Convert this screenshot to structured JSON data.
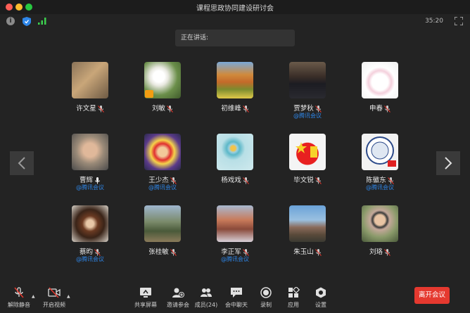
{
  "window": {
    "title": "课程思政协同建设研讨会"
  },
  "topbar": {
    "timer": "35:20"
  },
  "speaking": {
    "label": "正在讲话:"
  },
  "participants": [
    {
      "name": "许文星",
      "org": ""
    },
    {
      "name": "刘敏",
      "org": ""
    },
    {
      "name": "初维峰",
      "org": ""
    },
    {
      "name": "贾梦秋",
      "org": "@腾讯会议"
    },
    {
      "name": "申春",
      "org": ""
    },
    {
      "name": "曹辉",
      "org": "@腾讯会议"
    },
    {
      "name": "王少杰",
      "org": "@腾讯会议"
    },
    {
      "name": "杨戏戏",
      "org": ""
    },
    {
      "name": "毕文锐",
      "org": ""
    },
    {
      "name": "陈徽东",
      "org": "@腾讯会议"
    },
    {
      "name": "蔡昀",
      "org": "@腾讯会议"
    },
    {
      "name": "张桂敏",
      "org": ""
    },
    {
      "name": "李正军",
      "org": "@腾讯会议"
    },
    {
      "name": "朱玉山",
      "org": ""
    },
    {
      "name": "刘珞",
      "org": ""
    }
  ],
  "toolbar": {
    "unmute": "解除静音",
    "start_video": "开启视频",
    "share_screen": "共享屏幕",
    "invite": "邀请参会",
    "members": "成员(24)",
    "chat": "会中聊天",
    "record": "录制",
    "apps": "应用",
    "settings": "设置",
    "leave": "离开会议"
  },
  "colors": {
    "accent": "#2e86e8",
    "leave": "#e5392f",
    "background": "#232323"
  }
}
